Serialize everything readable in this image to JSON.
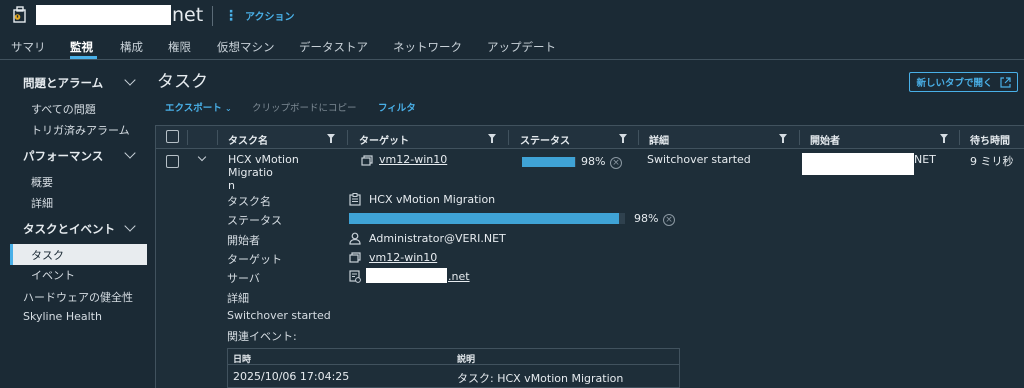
{
  "header": {
    "title_suffix": "net",
    "actions_label": "アクション"
  },
  "tabs": [
    {
      "label": "サマリ"
    },
    {
      "label": "監視",
      "active": true
    },
    {
      "label": "構成"
    },
    {
      "label": "権限"
    },
    {
      "label": "仮想マシン"
    },
    {
      "label": "データストア"
    },
    {
      "label": "ネットワーク"
    },
    {
      "label": "アップデート"
    }
  ],
  "sidebar": {
    "groups": [
      {
        "label": "問題とアラーム",
        "items": [
          "すべての問題",
          "トリガ済みアラーム"
        ]
      },
      {
        "label": "パフォーマンス",
        "items": [
          "概要",
          "詳細"
        ]
      },
      {
        "label": "タスクとイベント",
        "items": [
          "タスク",
          "イベント"
        ]
      }
    ],
    "selected": "タスク",
    "extra_items": [
      "ハードウェアの健全性",
      "Skyline Health"
    ]
  },
  "main": {
    "title": "タスク",
    "new_tab_label": "新しいタブで開く",
    "toolbar": {
      "export_label": "エクスポート",
      "copy_label": "クリップボードにコピー",
      "filter_label": "フィルタ"
    },
    "columns": [
      "タスク名",
      "ターゲット",
      "ステータス",
      "詳細",
      "開始者",
      "待ち時間"
    ],
    "row": {
      "task_name": "HCX vMotion Migratio\nn",
      "target": "vm12-win10",
      "progress_percent": 98,
      "progress_label": "98%",
      "details": "Switchover started",
      "initiator_suffix": "NET",
      "wait_time": "9 ミリ秒"
    },
    "detail": {
      "labels": {
        "task_name": "タスク名",
        "status": "ステータス",
        "initiator": "開始者",
        "target": "ターゲット",
        "server": "サーバ",
        "details": "詳細",
        "related_events": "関連イベント:"
      },
      "task_name": "HCX vMotion Migration",
      "progress_percent": 98,
      "progress_label": "98%",
      "initiator": "Administrator@VERI.NET",
      "target": "vm12-win10",
      "server_suffix": ".net",
      "details_text": "Switchover started"
    },
    "events": {
      "columns": [
        "日時",
        "説明"
      ],
      "rows": [
        {
          "datetime": "2025/10/06 17:04:25",
          "description": "タスク: HCX vMotion Migration"
        }
      ]
    }
  },
  "colors": {
    "background": "#1b2a35",
    "accent": "#49b0e8",
    "progress": "#3fa3d6"
  }
}
